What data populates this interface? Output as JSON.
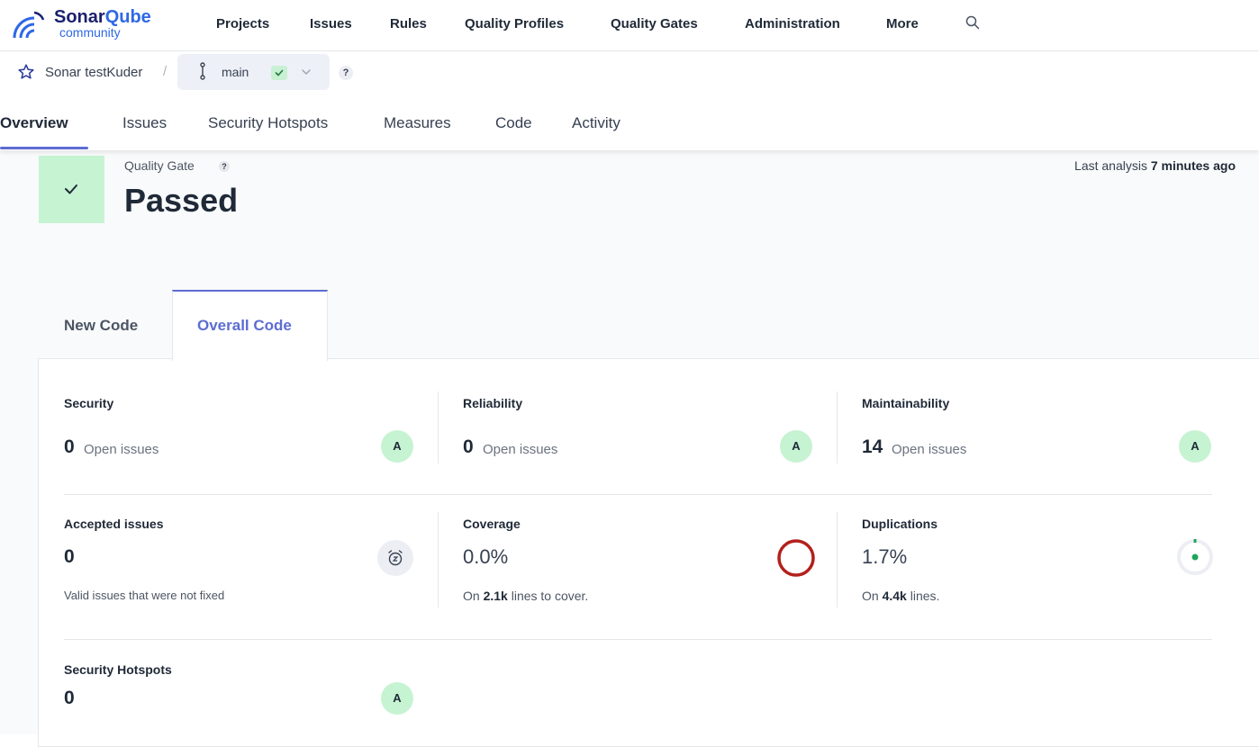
{
  "logo": {
    "brand_part1": "Sonar",
    "brand_part2": "Qube",
    "edition": "community"
  },
  "nav": [
    "Projects",
    "Issues",
    "Rules",
    "Quality Profiles",
    "Quality Gates",
    "Administration",
    "More"
  ],
  "breadcrumb": {
    "project": "Sonar testKuder",
    "separator": "/",
    "branch": "main",
    "help": "?"
  },
  "tabs": [
    "Overview",
    "Issues",
    "Security Hotspots",
    "Measures",
    "Code",
    "Activity"
  ],
  "quality_gate": {
    "label": "Quality Gate",
    "help": "?",
    "status": "Passed",
    "last_analysis_prefix": "Last analysis",
    "last_analysis_time": "7 minutes ago"
  },
  "code_tabs": {
    "new": "New Code",
    "overall": "Overall Code"
  },
  "metrics": {
    "security": {
      "title": "Security",
      "value": "0",
      "unit": "Open issues",
      "rating": "A"
    },
    "reliability": {
      "title": "Reliability",
      "value": "0",
      "unit": "Open issues",
      "rating": "A"
    },
    "maintainability": {
      "title": "Maintainability",
      "value": "14",
      "unit": "Open issues",
      "rating": "A"
    },
    "accepted": {
      "title": "Accepted issues",
      "value": "0",
      "note": "Valid issues that were not fixed"
    },
    "coverage": {
      "title": "Coverage",
      "value": "0.0%",
      "note_prefix": "On",
      "note_value": "2.1k",
      "note_suffix": "lines to cover."
    },
    "duplications": {
      "title": "Duplications",
      "value": "1.7%",
      "note_prefix": "On",
      "note_value": "4.4k",
      "note_suffix": "lines."
    },
    "hotspots": {
      "title": "Security Hotspots",
      "value": "0",
      "rating": "A"
    }
  },
  "colors": {
    "accent": "#5d6cd2",
    "pass": "#c6f3d2",
    "coverage_ring": "#b3201b",
    "duplication_dot": "#1fa55a"
  },
  "icons": [
    "sonarqube-logo-icon",
    "search-icon",
    "star-icon",
    "branch-icon",
    "check-icon",
    "chevron-down-icon",
    "help-icon",
    "snooze-clock-icon",
    "coverage-ring-icon",
    "duplication-dot-icon"
  ]
}
